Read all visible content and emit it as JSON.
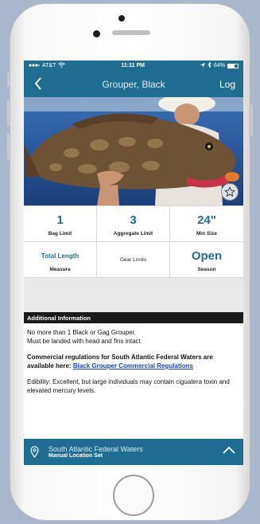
{
  "status_bar": {
    "carrier": "AT&T",
    "time": "11:11 PM",
    "battery": "64%"
  },
  "nav": {
    "back_icon": "chevron-left-icon",
    "title": "Grouper, Black",
    "log_label": "Log"
  },
  "hero": {
    "favorite_icon": "star-icon"
  },
  "stats": [
    {
      "value": "1",
      "label": "Bag Limit"
    },
    {
      "value": "3",
      "label": "Aggregate Limit"
    },
    {
      "value": "24\"",
      "label": "Min Size"
    },
    {
      "value": "Total Length",
      "label": "Measure"
    },
    {
      "value": "",
      "label": "Gear Limits"
    },
    {
      "value": "Open",
      "label": "Season"
    }
  ],
  "additional_info": {
    "header": "Additional Information",
    "line1": "No more than 1 Black or Gag Grouper.",
    "line2": "Must be landed with head and fins intact.",
    "commercial_text": "Commercial regulations for South Atlantic Federal Waters are available here:",
    "commercial_link": "Black Grouper Commercial Regulations",
    "edibility": "Edibility: Excellent, but large individuals may contain ciguatera toxin and elevated mercury levels."
  },
  "location": {
    "icon": "location-pin-icon",
    "title": "South Atlantic Federal Waters",
    "subtitle": "Manual Location Set",
    "expand_icon": "chevron-up-icon"
  },
  "colors": {
    "brand": "#1f6e92",
    "link": "#1a3fd0",
    "header_bg": "#1a1a1a"
  }
}
